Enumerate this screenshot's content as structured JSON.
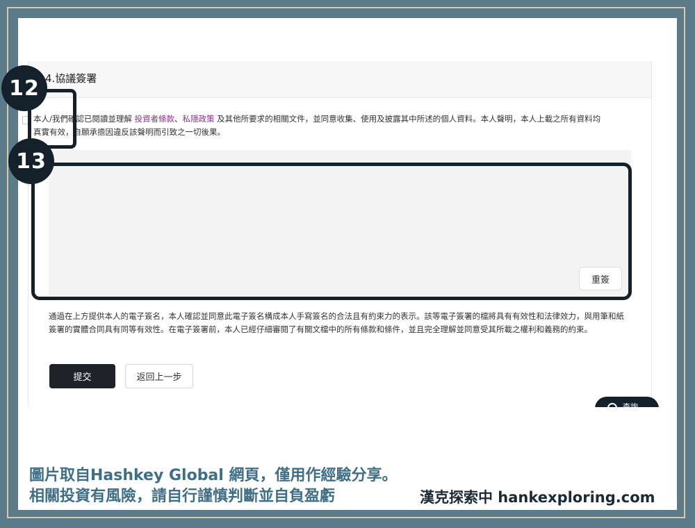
{
  "section": {
    "title": "4.協議簽署"
  },
  "agreement": {
    "text_before": "本人/我們確認已閱讀並理解 ",
    "link_terms": "投資者條款",
    "separator": "、",
    "link_privacy": "私隱政策",
    "text_after": " 及其他所要求的相關文件，並同意收集、使用及披露其中所述的個人資料。本人聲明，本人上載之所有資料均真實有效，自願承擔因違反該聲明而引致之一切後果。"
  },
  "signature": {
    "resign_label": "重簽"
  },
  "consent": {
    "text": "通過在上方提供本人的電子簽名，本人確認並同意此電子簽名構成本人手寫簽名的合法且有約束力的表示。該等電子簽署的檔將具有有效性和法律效力，與用筆和紙簽署的實體合同具有同等有效性。在電子簽署前，本人已經仔細審閱了有關文檔中的所有條款和條件，並且完全理解並同意受其所載之權利和義務的約束。"
  },
  "actions": {
    "submit_label": "提交",
    "back_label": "返回上一步"
  },
  "chat": {
    "label": "查詢",
    "icon": "chat-bubble-icon"
  },
  "annotations": {
    "badge_12": "12",
    "badge_13": "13"
  },
  "caption": {
    "line1": "圖片取自Hashkey Global 網頁，僅用作經驗分享。",
    "line2": "相關投資有風險，請自行謹慎判斷並自負盈虧"
  },
  "brand": {
    "text": "漢克探索中 hankexploring.com"
  },
  "colors": {
    "frame_background": "#5b7a8a",
    "frame_border": "#d8c9a8",
    "annotation_dark": "#14212b",
    "link": "#8a2f8a",
    "caption": "#3f6f86",
    "submit_background": "#1f2329"
  }
}
